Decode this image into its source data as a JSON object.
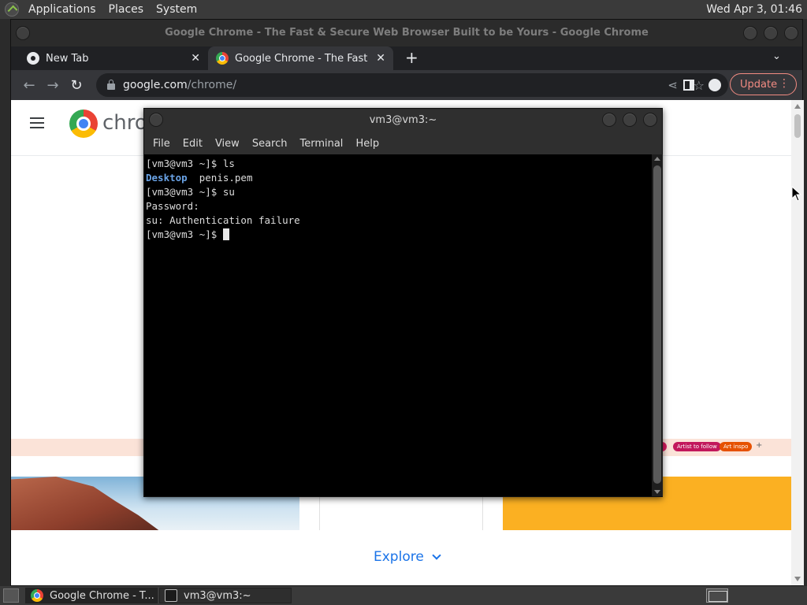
{
  "top_panel": {
    "menus": [
      "Applications",
      "Places",
      "System"
    ],
    "clock": "Wed Apr 3, 01:46"
  },
  "chrome": {
    "window_title": "Google Chrome - The Fast & Secure Web Browser Built to be Yours - Google Chrome",
    "tabs": [
      {
        "title": "New Tab",
        "icon": "chrome-newtab-icon"
      },
      {
        "title": "Google Chrome - The Fast & S",
        "icon": "chrome-logo-icon"
      }
    ],
    "new_tab_label": "+",
    "url_host": "google.com",
    "url_path": "/chrome/",
    "update_label": "Update",
    "page": {
      "brand": "chro",
      "chips": [
        {
          "label": "Artist to follow",
          "color": "#c2185b"
        },
        {
          "label": "Art inspo",
          "color": "#e65100"
        }
      ],
      "explore_label": "Explore"
    }
  },
  "terminal": {
    "title": "vm3@vm3:~",
    "menus": [
      "File",
      "Edit",
      "View",
      "Search",
      "Terminal",
      "Help"
    ],
    "lines": [
      {
        "prompt": "[vm3@vm3 ~]$ ",
        "text": "ls"
      },
      {
        "dir": "Desktop",
        "text": "  penis.pem"
      },
      {
        "prompt": "[vm3@vm3 ~]$ ",
        "text": "su"
      },
      {
        "text": "Password:"
      },
      {
        "text": "su: Authentication failure"
      },
      {
        "prompt": "[vm3@vm3 ~]$ ",
        "text": " "
      }
    ]
  },
  "bottom_panel": {
    "tasks": [
      {
        "label": "Google Chrome - T...",
        "icon": "chrome-logo-icon"
      },
      {
        "label": "vm3@vm3:~",
        "icon": "terminal-icon"
      }
    ]
  },
  "colors": {
    "terminal_bg": "#000000",
    "terminal_dir": "#6aa3e6",
    "update_accent": "#f28b82",
    "explore_link": "#1a73e8"
  }
}
